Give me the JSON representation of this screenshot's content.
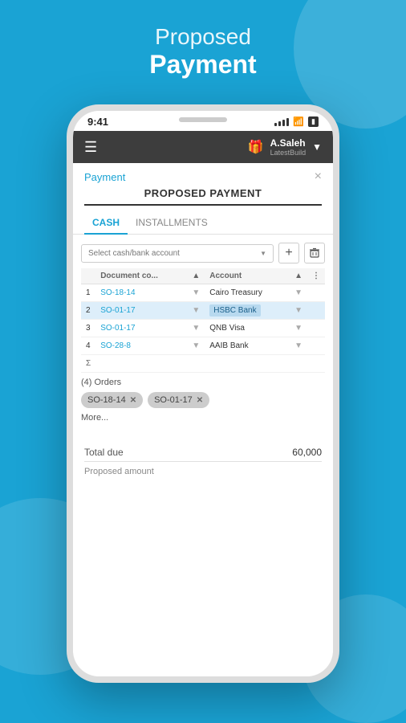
{
  "page": {
    "header_proposed": "Proposed",
    "header_payment": "Payment",
    "background_color": "#1aa3d4"
  },
  "status_bar": {
    "time": "9:41"
  },
  "top_nav": {
    "user_name": "A.Saleh",
    "user_sub": "LatestBuild"
  },
  "payment_section": {
    "link_label": "Payment",
    "title": "PROPOSED PAYMENT",
    "close_label": "×"
  },
  "tabs": [
    {
      "label": "CASH",
      "active": true
    },
    {
      "label": "INSTALLMENTS",
      "active": false
    }
  ],
  "select_field": {
    "placeholder": "Select cash/bank account"
  },
  "table": {
    "columns": [
      {
        "label": ""
      },
      {
        "label": "Document co..."
      },
      {
        "label": ""
      },
      {
        "label": "Account"
      },
      {
        "label": ""
      },
      {
        "label": ""
      }
    ],
    "rows": [
      {
        "num": "1",
        "doc": "SO-18-14",
        "account": "Cairo Treasury"
      },
      {
        "num": "2",
        "doc": "SO-01-17",
        "account": "HSBC Bank",
        "highlighted": true
      },
      {
        "num": "3",
        "doc": "SO-01-17",
        "account": "QNB Visa"
      },
      {
        "num": "4",
        "doc": "SO-28-8",
        "account": "AAIB Bank"
      }
    ],
    "sigma": "Σ"
  },
  "orders": {
    "count_label": "(4) Orders",
    "pills": [
      {
        "label": "SO-18-14"
      },
      {
        "label": "SO-01-17"
      }
    ],
    "more_label": "More..."
  },
  "totals": {
    "total_due_label": "Total due",
    "total_due_value": "60,000",
    "proposed_label": "Proposed amount"
  }
}
